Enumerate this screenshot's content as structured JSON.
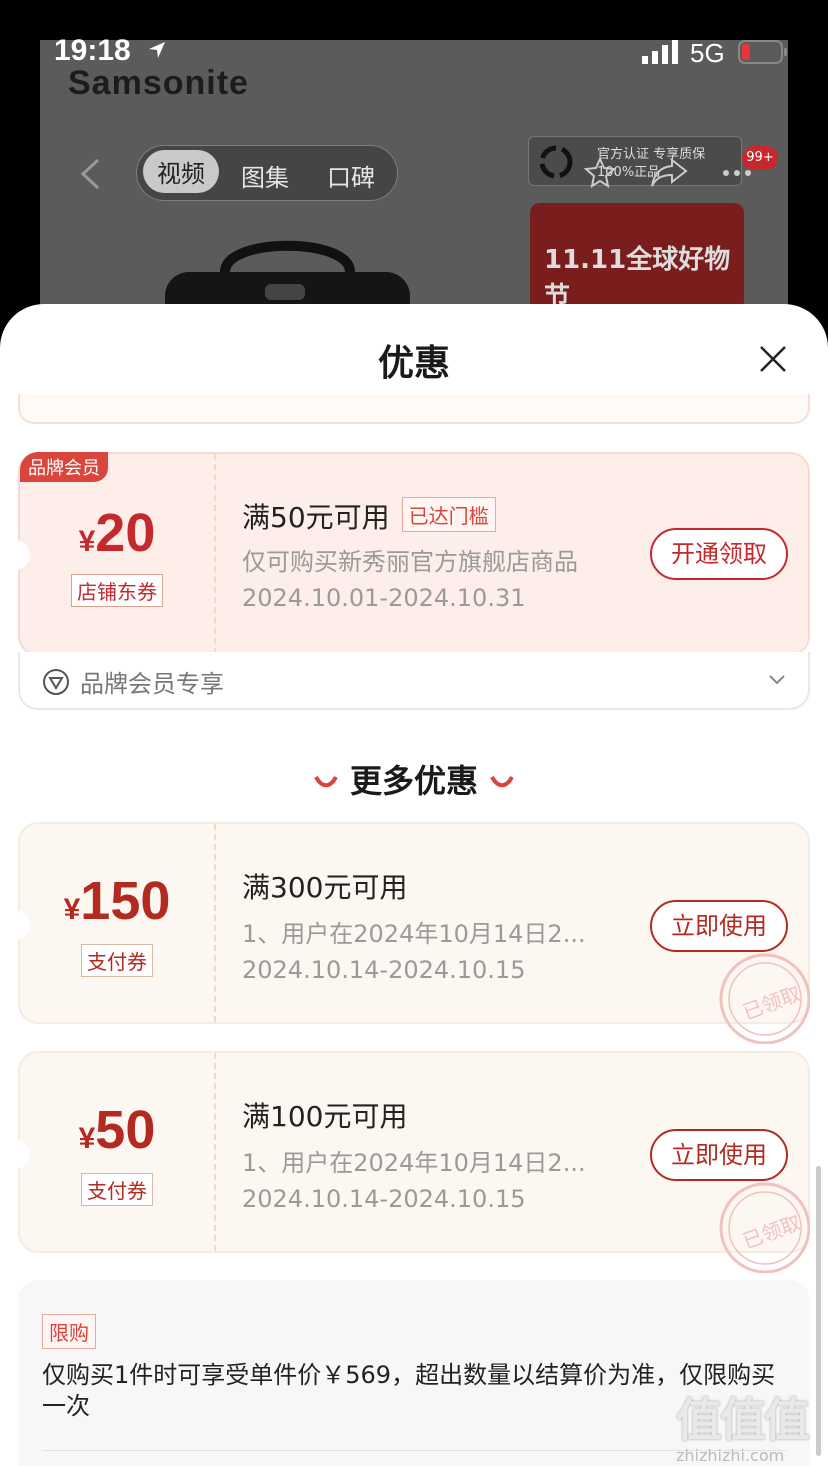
{
  "status_bar": {
    "time": "19:18",
    "network": "5G"
  },
  "product_page": {
    "brand_logo": "Samsonite",
    "media_tabs": [
      "视频",
      "图集",
      "口碑"
    ],
    "official_badge": {
      "line1": "官方认证 专享质保",
      "line2": "100%正品"
    },
    "cart_count": "99+",
    "promo_banner": "11.11全球好物节"
  },
  "sheet": {
    "title": "优惠",
    "member_coupon": {
      "label": "品牌会员",
      "currency": "¥",
      "amount": "20",
      "type": "店铺东券",
      "condition": "满50元可用",
      "threshold_tag": "已达门槛",
      "description": "仅可购买新秀丽官方旗舰店商品",
      "validity": "2024.10.01-2024.10.31",
      "button": "开通领取",
      "footer": "品牌会员专享"
    },
    "more_section_title": "更多优惠",
    "pay_coupons": [
      {
        "currency": "¥",
        "amount": "150",
        "type": "支付券",
        "condition": "满300元可用",
        "description": "1、用户在2024年10月14日2...",
        "validity": "2024.10.14-2024.10.15",
        "button": "立即使用",
        "stamp": "已领取"
      },
      {
        "currency": "¥",
        "amount": "50",
        "type": "支付券",
        "condition": "满100元可用",
        "description": "1、用户在2024年10月14日2...",
        "validity": "2024.10.14-2024.10.15",
        "button": "立即使用",
        "stamp": "已领取"
      }
    ],
    "limit": {
      "tag": "限购",
      "text": "仅购买1件时可享受单件价￥569，超出数量以结算价为准，仅限购买一次"
    }
  },
  "watermark": {
    "big": "值值值",
    "small": "zhizhizhi.com"
  },
  "colors": {
    "accent_red": "#c5282d",
    "member_bg": "#fdeeea",
    "pay_bg": "#fdf7f1"
  }
}
